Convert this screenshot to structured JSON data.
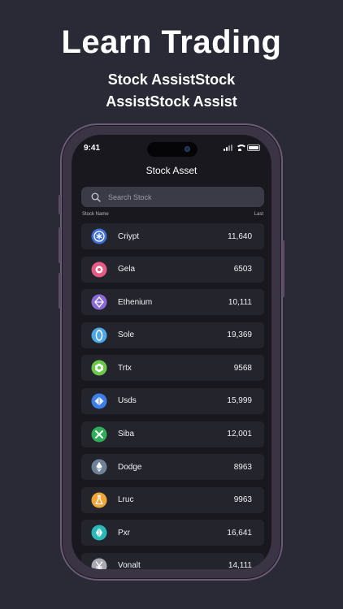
{
  "promo": {
    "headline": "Learn Trading",
    "sub_line1": "Stock AssistStock",
    "sub_line2": "AssistStock Assist"
  },
  "status_bar": {
    "time": "9:41"
  },
  "app": {
    "title": "Stock Asset",
    "search_placeholder": "Search Stock",
    "col_name": "Stock Name",
    "col_last": "Last"
  },
  "stocks": [
    {
      "name": "Criypt",
      "last": "11,640",
      "icon": "asterisk-coin-icon",
      "color": "#3d6fd8"
    },
    {
      "name": "Gela",
      "last": "6503",
      "icon": "flower-coin-icon",
      "color": "#e45b86"
    },
    {
      "name": "Ethenium",
      "last": "10,111",
      "icon": "diamond-coin-icon",
      "color": "#8b6ad6"
    },
    {
      "name": "Sole",
      "last": "19,369",
      "icon": "oval-coin-icon",
      "color": "#4da8e8"
    },
    {
      "name": "Trtx",
      "last": "9568",
      "icon": "hexagon-coin-icon",
      "color": "#6bc94a"
    },
    {
      "name": "Usds",
      "last": "15,999",
      "icon": "rhombus-coin-icon",
      "color": "#3f7ee8"
    },
    {
      "name": "Siba",
      "last": "12,001",
      "icon": "cross-coin-icon",
      "color": "#2fae58"
    },
    {
      "name": "Dodge",
      "last": "8963",
      "icon": "ether-coin-icon",
      "color": "#6f8196"
    },
    {
      "name": "Lruc",
      "last": "9963",
      "icon": "flask-coin-icon",
      "color": "#f0a43a"
    },
    {
      "name": "Pxr",
      "last": "16,641",
      "icon": "crystal-coin-icon",
      "color": "#2ab8b8"
    },
    {
      "name": "Vonalt",
      "last": "14,111",
      "icon": "yen-coin-icon",
      "color": "#a9a9b4"
    }
  ]
}
